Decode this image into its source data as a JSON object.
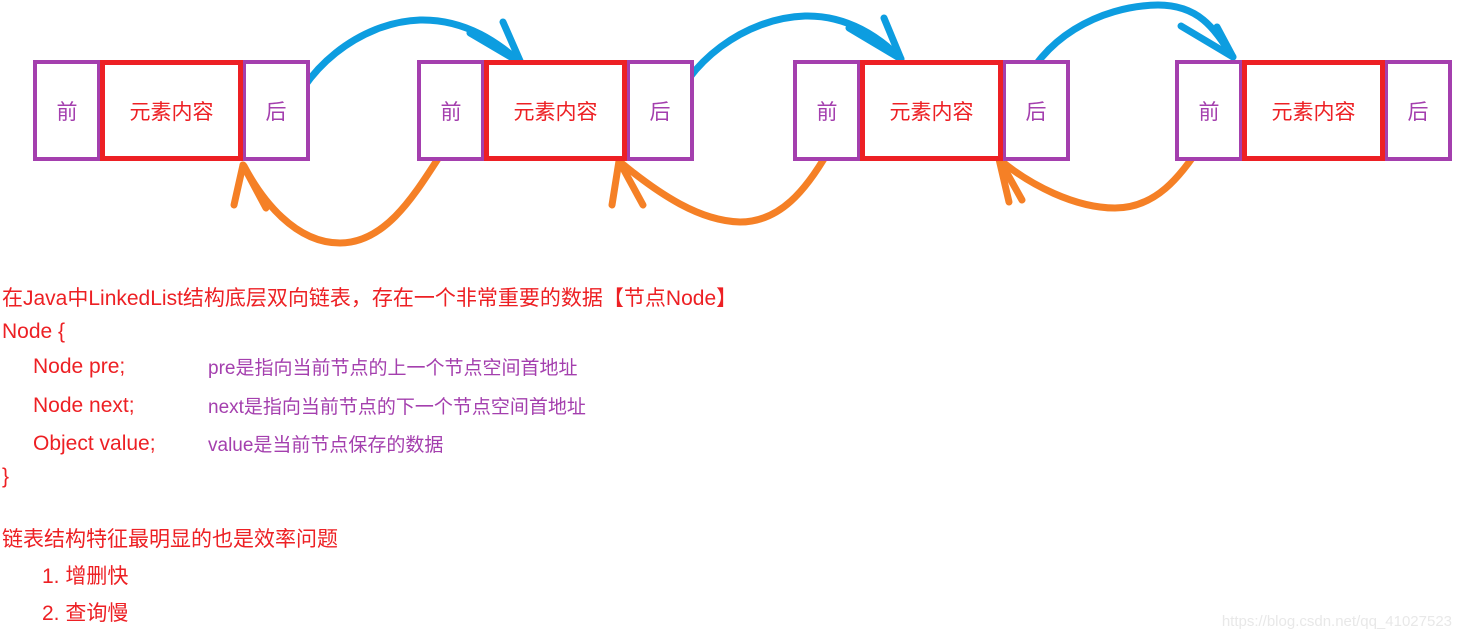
{
  "colors": {
    "red": "#ed2024",
    "purple": "#a43fae",
    "blue": "#0d9de0",
    "orange": "#f58026",
    "watermark": "#e8e8e8"
  },
  "diagram": {
    "node_count": 4,
    "cell_labels": {
      "prev": "前",
      "value": "元素内容",
      "next": "后"
    },
    "nodes": [
      {
        "prev": "前",
        "value": "元素内容",
        "next": "后"
      },
      {
        "prev": "前",
        "value": "元素内容",
        "next": "后"
      },
      {
        "prev": "前",
        "value": "元素内容",
        "next": "后"
      },
      {
        "prev": "前",
        "value": "元素内容",
        "next": "后"
      }
    ]
  },
  "text": {
    "intro": "在Java中LinkedList结构底层双向链表，存在一个非常重要的数据【节点Node】",
    "class_open": "Node {",
    "class_close": "}",
    "fields": [
      {
        "decl": "Node pre;",
        "comment": "pre是指向当前节点的上一个节点空间首地址"
      },
      {
        "decl": "Node next;",
        "comment": "next是指向当前节点的下一个节点空间首地址"
      },
      {
        "decl": "Object value;",
        "comment": "value是当前节点保存的数据"
      }
    ],
    "summary": "链表结构特征最明显的也是效率问题",
    "points": [
      "1. 增删快",
      "2. 查询慢"
    ]
  },
  "watermark": "https://blog.csdn.net/qq_41027523"
}
